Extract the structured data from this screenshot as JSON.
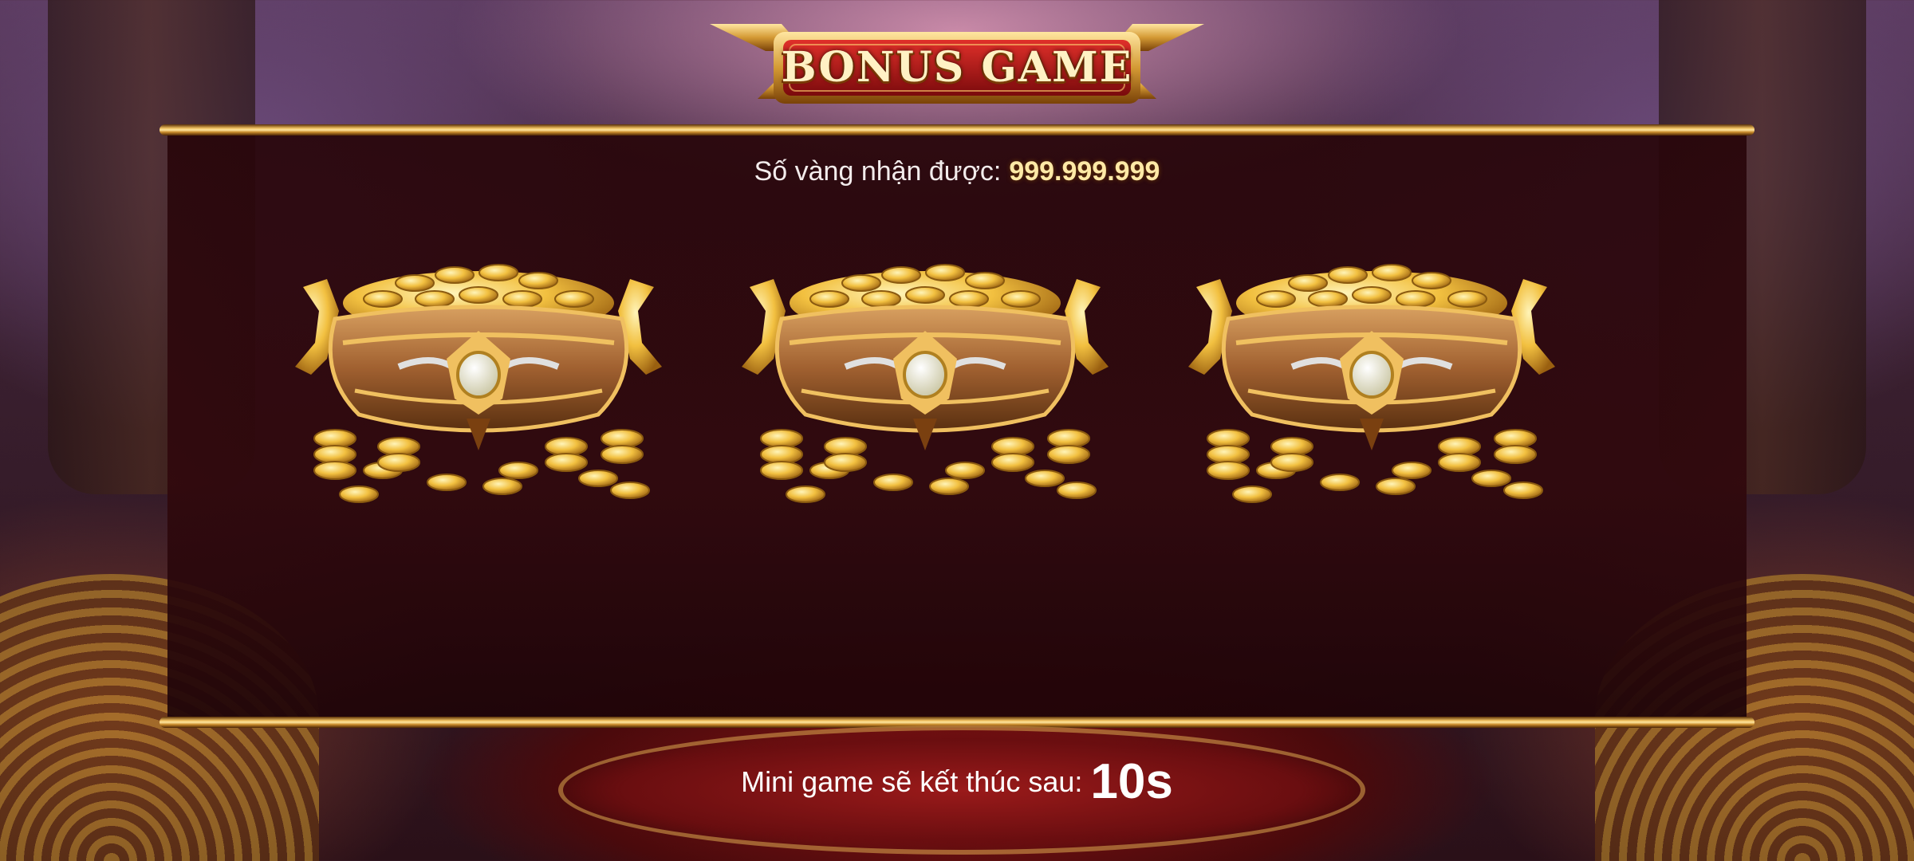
{
  "title": "BONUS GAME",
  "reward": {
    "label": "Số vàng nhận được:",
    "amount": "999.999.999"
  },
  "pots": [
    {
      "name": "pot-1"
    },
    {
      "name": "pot-2"
    },
    {
      "name": "pot-3"
    }
  ],
  "countdown": {
    "label": "Mini game sẽ kết thúc sau:",
    "value": "10s"
  },
  "colors": {
    "gold": "#f0c060",
    "banner_red": "#b0161a",
    "amount": "#ffe9a6",
    "panel": "#2a0608"
  }
}
